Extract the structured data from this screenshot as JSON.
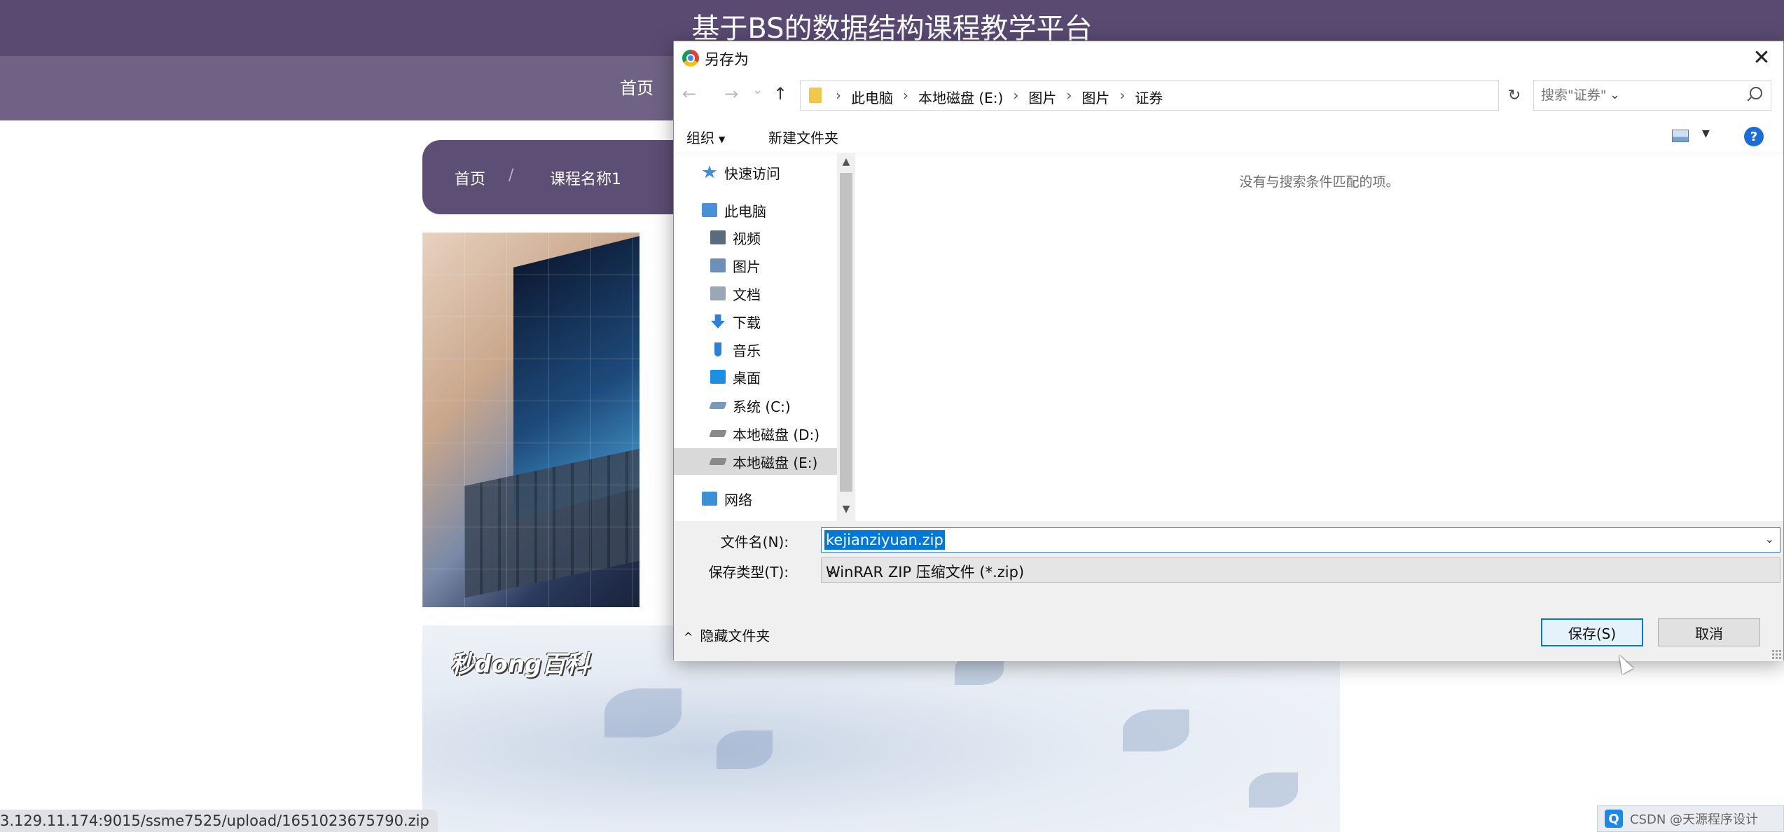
{
  "site": {
    "title": "基于BS的数据结构课程教学平台",
    "nav_home": "首页",
    "breadcrumb": {
      "home": "首页",
      "separator": "/",
      "current": "课程名称1"
    },
    "banner_logo": "秒dong百科",
    "status_url": "3.129.11.174:9015/ssme7525/upload/1651023675790.zip",
    "side_tab_icon": "‹",
    "tray_text": "CSDN @天源程序设计"
  },
  "dialog": {
    "title": "另存为",
    "close_icon": "✕",
    "address": {
      "back": "←",
      "forward": "→",
      "recent": "⌄",
      "up": "↑",
      "crumbs": [
        "此电脑",
        "本地磁盘 (E:)",
        "图片",
        "图片",
        "证券"
      ],
      "crumb_sep": "›",
      "dropdown": "⌄",
      "refresh": "↻"
    },
    "search": {
      "placeholder": "搜索\"证券\""
    },
    "toolbar": {
      "organize": "组织",
      "new_folder": "新建文件夹",
      "help": "?"
    },
    "nav_items": [
      {
        "label": "快速访问",
        "icon": "star-icon",
        "color": "#3f8fdc"
      },
      {
        "label": "此电脑",
        "icon": "computer-icon",
        "color": "#4a90d9"
      },
      {
        "label": "视频",
        "icon": "video-icon",
        "color": "#5a6b7d"
      },
      {
        "label": "图片",
        "icon": "pictures-icon",
        "color": "#6f8fb8"
      },
      {
        "label": "文档",
        "icon": "document-icon",
        "color": "#9aa7b5"
      },
      {
        "label": "下载",
        "icon": "download-icon",
        "color": "#2f7fd8"
      },
      {
        "label": "音乐",
        "icon": "music-icon",
        "color": "#2f7fd8"
      },
      {
        "label": "桌面",
        "icon": "desktop-icon",
        "color": "#1e8fe0"
      },
      {
        "label": "系统 (C:)",
        "icon": "system-drive-icon",
        "color": "#7a9ab8"
      },
      {
        "label": "本地磁盘 (D:)",
        "icon": "drive-icon",
        "color": "#8a8a8a"
      },
      {
        "label": "本地磁盘 (E:)",
        "icon": "drive-icon",
        "color": "#8a8a8a"
      },
      {
        "label": "网络",
        "icon": "network-icon",
        "color": "#3a8fd6"
      }
    ],
    "selected_nav": "本地磁盘 (E:)",
    "empty_message": "没有与搜索条件匹配的项。",
    "fields": {
      "filename_label": "文件名(N):",
      "filename_value": "kejianziyuan.zip",
      "filetype_label": "保存类型(T):",
      "filetype_value": "WinRAR ZIP 压缩文件 (*.zip)"
    },
    "hide_folders": "隐藏文件夹",
    "save_button": "保存(S)",
    "cancel_button": "取消",
    "accent_color": "#0078d7"
  }
}
